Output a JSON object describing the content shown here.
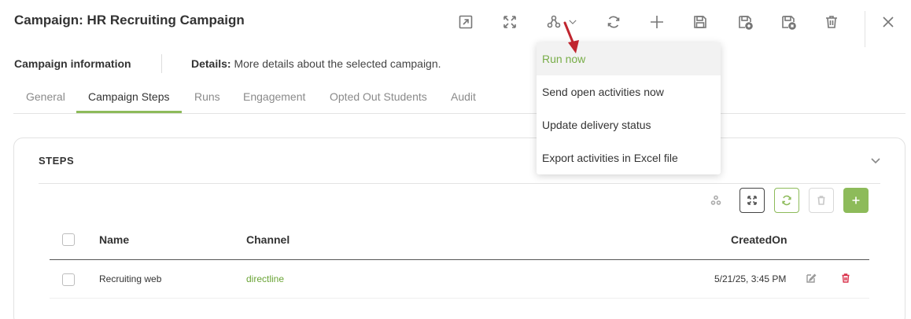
{
  "header": {
    "title": "Campaign: HR Recruiting Campaign",
    "icons": [
      "open-in-new-icon",
      "expand-icon",
      "workflow-icon",
      "chevron-down-icon",
      "refresh-icon",
      "plus-icon",
      "save-icon",
      "save-and-new-icon",
      "save-and-close-icon",
      "trash-icon",
      "close-icon"
    ]
  },
  "info": {
    "label": "Campaign information",
    "details_label": "Details:",
    "details_text": " More details about the selected campaign."
  },
  "tabs": [
    "General",
    "Campaign Steps",
    "Runs",
    "Engagement",
    "Opted Out Students",
    "Audit"
  ],
  "active_tab": "Campaign Steps",
  "steps": {
    "title": "STEPS",
    "columns": [
      "Name",
      "Channel",
      "CreatedOn"
    ],
    "rows": [
      {
        "name": "Recruiting web",
        "channel": "directline",
        "created_on": "5/21/25, 3:45 PM"
      }
    ]
  },
  "menu": {
    "items": [
      "Run now",
      "Send open activities now",
      "Update delivery status",
      "Export activities in Excel file"
    ],
    "highlighted": "Run now"
  },
  "colors": {
    "accent": "#8dbb5a",
    "link": "#6aa436",
    "highlight_text": "#78ad48",
    "danger": "#d9304a",
    "arrow": "#c0262f"
  }
}
